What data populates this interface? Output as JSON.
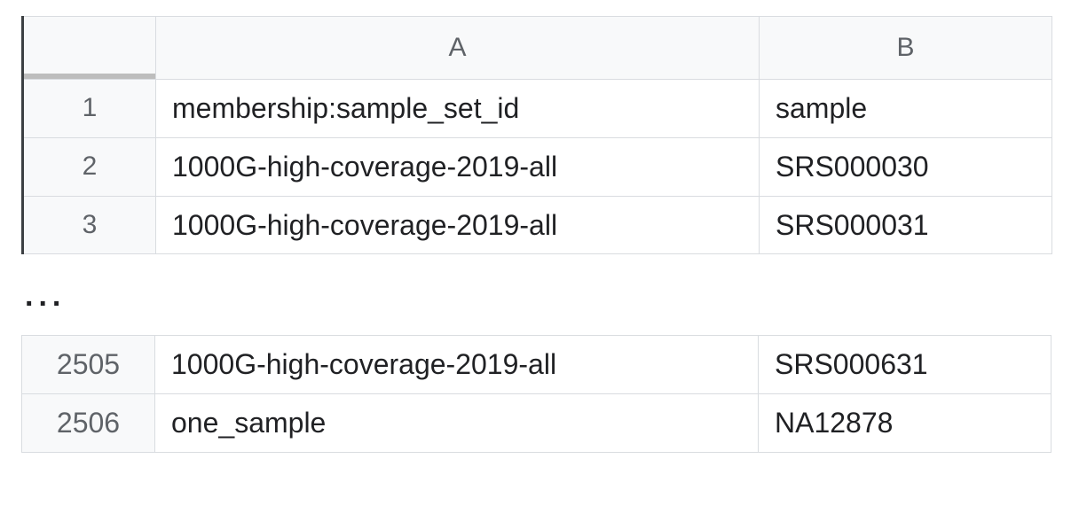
{
  "columns": {
    "A": "A",
    "B": "B"
  },
  "segment1": {
    "rows": [
      {
        "num": "1",
        "A": "membership:sample_set_id",
        "B": "sample"
      },
      {
        "num": "2",
        "A": "1000G-high-coverage-2019-all",
        "B": "SRS000030"
      },
      {
        "num": "3",
        "A": "1000G-high-coverage-2019-all",
        "B": "SRS000031"
      }
    ]
  },
  "ellipsis": "...",
  "segment2": {
    "rows": [
      {
        "num": "2505",
        "A": "1000G-high-coverage-2019-all",
        "B": "SRS000631"
      },
      {
        "num": "2506",
        "A": "one_sample",
        "B": "NA12878"
      }
    ]
  }
}
